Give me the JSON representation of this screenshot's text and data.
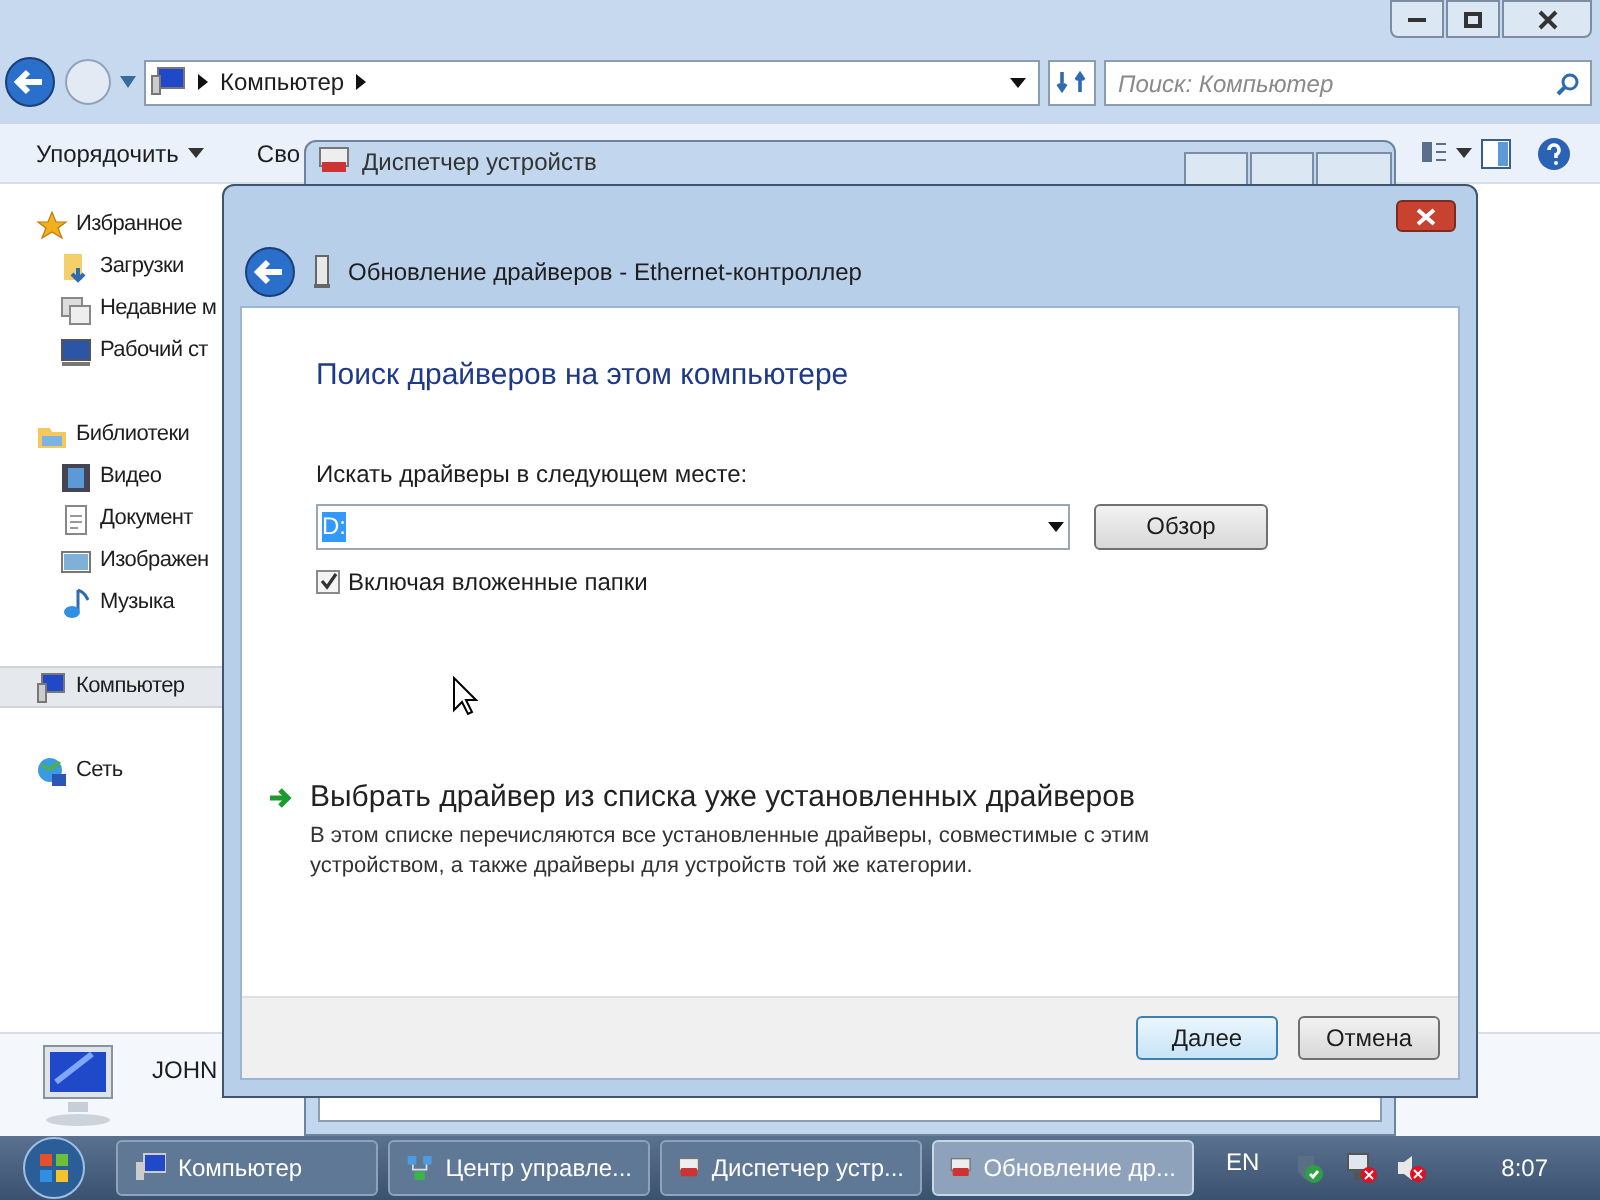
{
  "explorer": {
    "address_crumbs": [
      "Компьютер"
    ],
    "search": {
      "placeholder": "Поиск: Компьютер"
    },
    "toolbar": [
      "Упорядочить",
      "Сво"
    ],
    "nav": [
      {
        "label": "Избранное",
        "selected": false,
        "children": [
          {
            "label": "Загрузки",
            "selected": false
          },
          {
            "label": "Недавние м",
            "selected": false
          },
          {
            "label": "Рабочий ст",
            "selected": false
          }
        ]
      },
      {
        "label": "Библиотеки",
        "selected": false,
        "children": [
          {
            "label": "Видео",
            "selected": false
          },
          {
            "label": "Документ",
            "selected": false
          },
          {
            "label": "Изображен",
            "selected": false
          },
          {
            "label": "Музыка",
            "selected": false
          }
        ]
      },
      {
        "label": "Компьютер",
        "selected": true
      },
      {
        "label": "Сеть",
        "selected": false
      }
    ],
    "details_name": "JOHN"
  },
  "device_manager": {
    "title": "Диспетчер устройств"
  },
  "wizard": {
    "title": "Обновление драйверов - Ethernet-контроллер",
    "heading": "Поиск драйверов на этом компьютере",
    "location_label": "Искать драйверы в следующем месте:",
    "location_value": "D:",
    "browse": "Обзор",
    "include_subfolders": {
      "label": "Включая вложенные папки",
      "checked": true
    },
    "option": {
      "title": "Выбрать драйвер из списка уже установленных драйверов",
      "description": "В этом списке перечисляются все установленные драйверы, совместимые с этим устройством, а также драйверы для устройств той же категории."
    },
    "buttons": [
      {
        "label": "Далее",
        "default": true
      },
      {
        "label": "Отмена",
        "default": false
      }
    ]
  },
  "taskbar": {
    "tasks": [
      {
        "label": "Компьютер",
        "selected": false
      },
      {
        "label": "Центр управле...",
        "selected": false
      },
      {
        "label": "Диспетчер устр...",
        "selected": false
      },
      {
        "label": "Обновление др...",
        "selected": true
      }
    ],
    "language": "EN",
    "time": "8:07"
  }
}
